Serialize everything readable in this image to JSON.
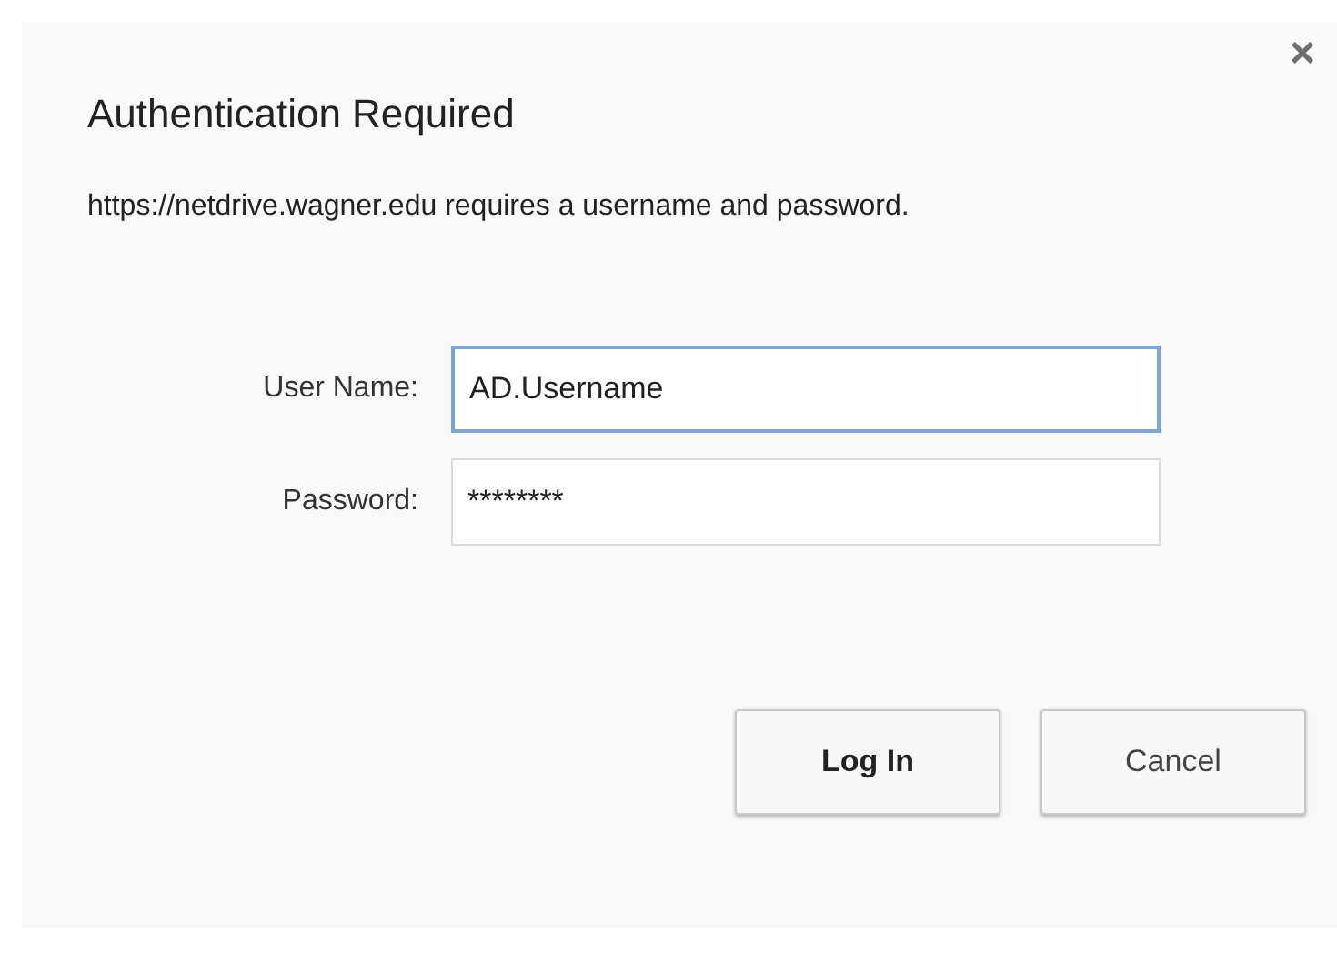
{
  "dialog": {
    "title": "Authentication Required",
    "close": "×",
    "message": "https://netdrive.wagner.edu requires a username and password."
  },
  "fields": [
    {
      "label": "User Name:",
      "value": "AD.Username",
      "focused": true
    },
    {
      "label": "Password:",
      "value": "********",
      "focused": false
    }
  ],
  "buttons": [
    {
      "label": "Log In",
      "kind": "primary"
    },
    {
      "label": "Cancel",
      "kind": "secondary"
    }
  ]
}
